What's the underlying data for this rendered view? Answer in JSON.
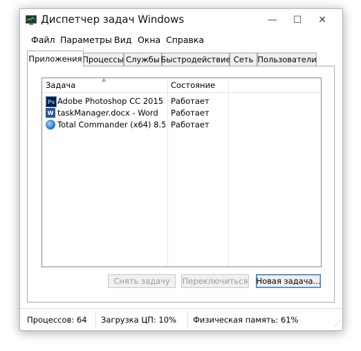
{
  "window": {
    "title": "Диспетчер задач Windows",
    "icon": "task-manager-icon",
    "controls": {
      "minimize": "—",
      "maximize": "☐",
      "close": "✕"
    }
  },
  "menu": [
    "Файл",
    "Параметры",
    "Вид",
    "Окна",
    "Справка"
  ],
  "tabs": [
    "Приложения",
    "Процессы",
    "Службы",
    "Быстродействие",
    "Сеть",
    "Пользователи"
  ],
  "active_tab": "Приложения",
  "applications": {
    "columns": [
      "Задача",
      "Состояние"
    ],
    "rows": [
      {
        "task": "Adobe Photoshop CC 2015",
        "state": "Работает",
        "icon": "photoshop-icon",
        "icon_label": "Ps",
        "icon_color": "#0e1b3b"
      },
      {
        "task": "taskManager.docx - Word",
        "state": "Работает",
        "icon": "word-icon",
        "icon_label": "W",
        "icon_color": "#2b579a"
      },
      {
        "task": "Total Commander (x64) 8.50 ...",
        "state": "Работает",
        "icon": "total-commander-icon",
        "icon_label": "",
        "icon_color": "#3a8ad6"
      }
    ]
  },
  "buttons": {
    "end_task": "Снять задачу",
    "switch_to": "Переключиться",
    "new_task": "Новая задача..."
  },
  "status": {
    "processes": "Процессов: 64",
    "cpu": "Загрузка ЦП: 10%",
    "memory": "Физическая память: 61%"
  }
}
